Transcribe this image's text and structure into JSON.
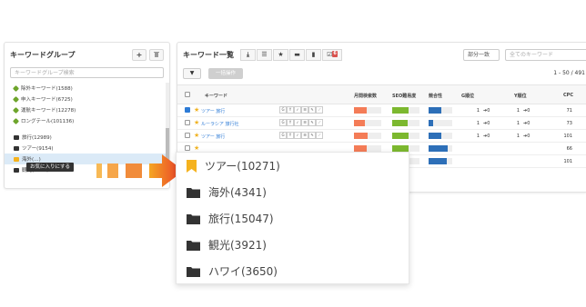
{
  "left_panel": {
    "title": "キーワードグループ",
    "add_label": "+",
    "search_placeholder": "キーワードグループ検索",
    "tree": [
      {
        "label": "除外キーワード(1588)",
        "type": "tag"
      },
      {
        "label": "申入キーワード(6725)",
        "type": "tag"
      },
      {
        "label": "運航キーワード(12278)",
        "type": "tag"
      },
      {
        "label": "ロングテール(101136)",
        "type": "tag"
      },
      {
        "label": "旅行(12989)",
        "type": "folder"
      },
      {
        "label": "ツアー(9154)",
        "type": "folder"
      },
      {
        "label": "海外(…)",
        "type": "folder"
      },
      {
        "label": "観光(3429)",
        "type": "folder"
      }
    ],
    "tooltip": "お気に入りにする"
  },
  "right_panel": {
    "title": "キーワード一覧",
    "badge": "6",
    "select_value": "部分一致",
    "search_placeholder": "全てのキーワード",
    "bulk_label": "一括操作",
    "pager": "1 - 50 / 491",
    "headers": {
      "keyword": "キーワード",
      "volume": "月間検索数",
      "seo": "SEO難易度",
      "ads": "競合性",
      "g_rank": "G順位",
      "y_rank": "Y順位",
      "cpc": "CPC"
    },
    "rows": [
      {
        "keyword": "ツアー 旅行",
        "checked": true,
        "vol": 0.45,
        "seo": 0.6,
        "ads": 0.55,
        "g": "1",
        "y": "1",
        "cpc": "71"
      },
      {
        "keyword": "ルーラシア 旅行社",
        "checked": false,
        "vol": 0.4,
        "seo": 0.55,
        "ads": 0.2,
        "g": "1",
        "y": "1",
        "cpc": "73"
      },
      {
        "keyword": "ツアー 旅行",
        "checked": false,
        "vol": 0.5,
        "seo": 0.6,
        "ads": 0.55,
        "g": "1",
        "y": "1",
        "cpc": "101"
      },
      {
        "keyword": "",
        "checked": false,
        "vol": 0.45,
        "seo": 0.6,
        "ads": 0.8,
        "g": "",
        "y": "",
        "cpc": "66"
      },
      {
        "keyword": "",
        "checked": false,
        "vol": 0.45,
        "seo": 0.6,
        "ads": 0.75,
        "g": "",
        "y": "",
        "cpc": "101"
      }
    ],
    "mini_icons": [
      "G",
      "Y",
      "✓",
      "☰",
      "✎",
      "⟋"
    ],
    "arrow_symbol": "➔0"
  },
  "dropdown": {
    "items": [
      {
        "label": "ツアー(10271)",
        "icon": "bookmark-icon"
      },
      {
        "label": "海外(4341)",
        "icon": "folder-icon"
      },
      {
        "label": "旅行(15047)",
        "icon": "folder-icon"
      },
      {
        "label": "観光(3921)",
        "icon": "folder-icon"
      },
      {
        "label": "ハワイ(3650)",
        "icon": "folder-icon"
      }
    ]
  },
  "colors": {
    "volume": "#f47c57",
    "seo": "#7cb82f",
    "ads": "#2d6fb8",
    "bookmark": "#f5b21e",
    "arrow": "#e8382a"
  }
}
